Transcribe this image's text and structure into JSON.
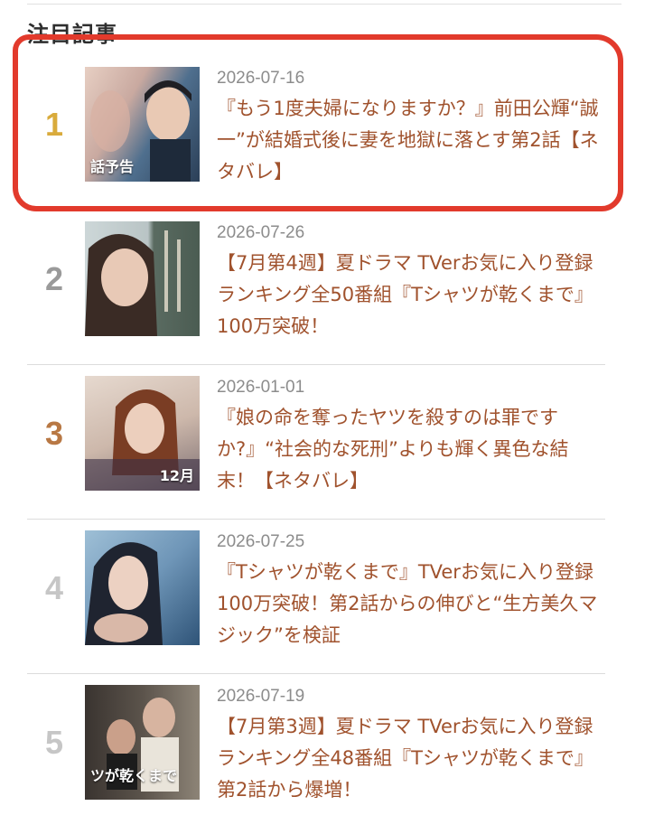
{
  "section": {
    "title": "注目記事"
  },
  "articles": [
    {
      "rank": "1",
      "date": "2026-07-16",
      "title": "『もう1度夫婦になりますか？』前田公輝“誠一”が結婚式後に妻を地獄に落とす第2話【ネタバレ】",
      "thumb_text": "話予告"
    },
    {
      "rank": "2",
      "date": "2026-07-26",
      "title": "【7月第4週】夏ドラマ TVerお気に入り登録ランキング全50番組『Tシャツが乾くまで』100万突破！",
      "thumb_text": ""
    },
    {
      "rank": "3",
      "date": "2026-01-01",
      "title": "『娘の命を奪ったヤツを殺すのは罪ですか?』“社会的な死刑”よりも輝く異色な結末！【ネタバレ】",
      "thumb_text": "12月"
    },
    {
      "rank": "4",
      "date": "2026-07-25",
      "title": "『Tシャツが乾くまで』TVerお気に入り登録100万突破！第2話からの伸びと“生方美久マジック”を検証",
      "thumb_text": ""
    },
    {
      "rank": "5",
      "date": "2026-07-19",
      "title": "【7月第3週】夏ドラマ TVerお気に入り登録ランキング全48番組『Tシャツが乾くまで』第2話から爆増！",
      "thumb_text": "ツが乾くまで"
    }
  ],
  "colors": {
    "rank_1": "#d9ab3c",
    "rank_2": "#9a9a9a",
    "rank_3": "#b87844",
    "rank_4": "#c6c6c6",
    "rank_5": "#c6c6c6",
    "title": "#a0522d",
    "annotation": "#e23a2c"
  }
}
